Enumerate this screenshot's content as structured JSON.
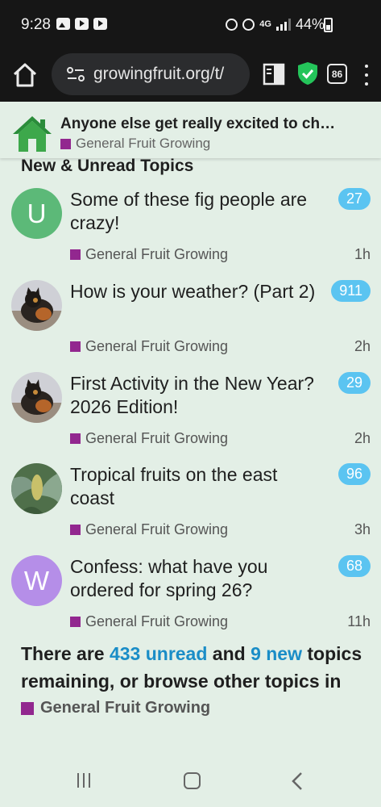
{
  "status_bar": {
    "time": "9:28",
    "network": "4G",
    "battery": "44%"
  },
  "browser": {
    "url": "growingfruit.org/t/",
    "tab_count": "86"
  },
  "header": {
    "title": "Anyone else get really excited to ch…",
    "category": "General Fruit Growing"
  },
  "list": {
    "heading": "New & Unread Topics",
    "topics": [
      {
        "avatar_letter": "U",
        "avatar_color": "#5cb978",
        "title": "Some of these fig people are crazy!",
        "category": "General Fruit Growing",
        "count": "27",
        "age": "1h"
      },
      {
        "avatar_letter": "",
        "avatar_color": "#8a7a6a",
        "title": "How is your weather? (Part 2)",
        "category": "General Fruit Growing",
        "count": "911",
        "age": "2h"
      },
      {
        "avatar_letter": "",
        "avatar_color": "#8a7a6a",
        "title": "First Activity in the New Year? 2026 Edition!",
        "category": "General Fruit Growing",
        "count": "29",
        "age": "2h"
      },
      {
        "avatar_letter": "",
        "avatar_color": "#4f6f4a",
        "title": "Tropical fruits on the east coast",
        "category": "General Fruit Growing",
        "count": "96",
        "age": "3h"
      },
      {
        "avatar_letter": "W",
        "avatar_color": "#b58ee8",
        "title": "Confess: what have you ordered for spring 26?",
        "category": "General Fruit Growing",
        "count": "68",
        "age": "11h"
      }
    ]
  },
  "footer": {
    "prefix": "There are ",
    "unread_link": "433 unread",
    "middle": " and ",
    "new_link": "9 new",
    "suffix": " topics remaining, or browse other topics in",
    "category": "General Fruit Growing"
  },
  "colors": {
    "category": "#92278f",
    "badge": "#5bc4f1",
    "link": "#1a8dc7",
    "background": "#e3efe6"
  }
}
